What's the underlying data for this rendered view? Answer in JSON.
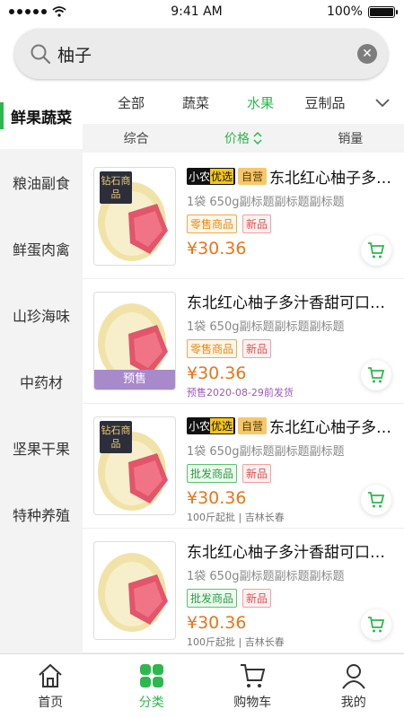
{
  "status_bar": {
    "time": "9:41 AM",
    "battery": "100%",
    "signal_icon": "signal-dots-icon",
    "wifi_icon": "wifi-icon",
    "battery_icon": "battery-icon"
  },
  "search": {
    "value": "柚子",
    "icon": "search-icon",
    "clear_icon": "clear-icon"
  },
  "sidebar": {
    "items": [
      {
        "label": "鲜果蔬菜",
        "active": true
      },
      {
        "label": "粮油副食"
      },
      {
        "label": "鲜蛋肉禽"
      },
      {
        "label": "山珍海味"
      },
      {
        "label": "中药材"
      },
      {
        "label": "坚果干果"
      },
      {
        "label": "特种养殖"
      }
    ]
  },
  "category_tabs": [
    {
      "label": "全部"
    },
    {
      "label": "蔬菜"
    },
    {
      "label": "水果",
      "active": true
    },
    {
      "label": "豆制品"
    }
  ],
  "sort_bar": {
    "comprehensive": "综合",
    "price": "价格",
    "sales": "销量"
  },
  "products": [
    {
      "tag1": "小农",
      "tag1b": "优选",
      "tag2": "自营",
      "title": "东北红心柚子多汁香甜可口",
      "subtitle": "1袋 650g副标题副标题副标题",
      "badge1": "零售商品",
      "badge2": "新品",
      "price": "¥30.36",
      "note": "",
      "thumb_label": "钻石商品"
    },
    {
      "title": "东北红心柚子多汁香甜可口多汁",
      "subtitle": "1袋 650g副标题副标题副标题",
      "badge1": "零售商品",
      "badge2": "新品",
      "price": "¥30.36",
      "note": "预售2020-08-29前发货",
      "thumb_label": "预售"
    },
    {
      "tag1": "小农",
      "tag1b": "优选",
      "tag2": "自营",
      "title": "东北红心柚子多汁香甜可口",
      "subtitle": "1袋 650g副标题副标题副标题",
      "badge1": "批发商品",
      "badge2": "新品",
      "price": "¥30.36",
      "note": "100斤起批 | 吉林长春",
      "thumb_label": "钻石商品"
    },
    {
      "title": "东北红心柚子多汁香甜可口多汁",
      "subtitle": "1袋 650g副标题副标题副标题",
      "badge1": "批发商品",
      "badge2": "新品",
      "price": "¥30.36",
      "note": "100斤起批 | 吉林长春"
    }
  ],
  "bottom_nav": [
    {
      "label": "首页",
      "icon": "home-icon"
    },
    {
      "label": "分类",
      "icon": "category-icon",
      "active": true
    },
    {
      "label": "购物车",
      "icon": "cart-icon"
    },
    {
      "label": "我的",
      "icon": "profile-icon"
    }
  ],
  "colors": {
    "accent": "#2db84d",
    "price": "#e8751a"
  }
}
